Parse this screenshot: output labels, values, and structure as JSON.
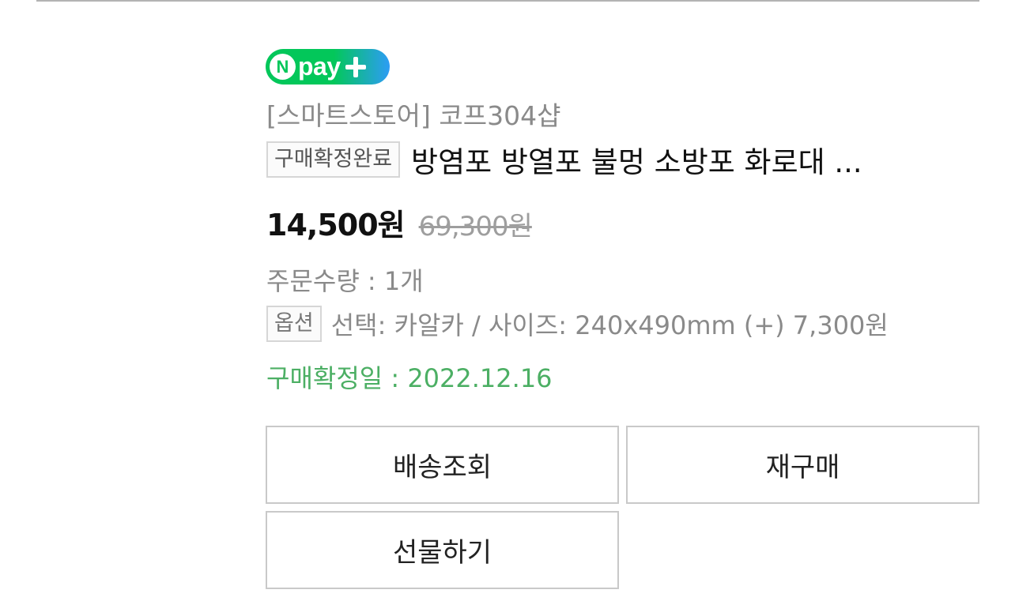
{
  "badge": {
    "n_letter": "N",
    "pay_text": "pay",
    "icon": "plus-icon",
    "colors": {
      "green": "#03c75a",
      "blue": "#2d9cf5"
    }
  },
  "order": {
    "store": "[스마트스토어] 코프304샵",
    "status_tag": "구매확정완료",
    "product_title": "방염포 방열포 불멍 소방포 화로대 ...",
    "sale_price": "14,500원",
    "original_price": "69,300원",
    "quantity": "주문수량 : 1개",
    "option_tag": "옵션",
    "option_text": "선택: 카알카 / 사이즈: 240x490mm (+) 7,300원",
    "confirm_date": "구매확정일 : 2022.12.16"
  },
  "actions": {
    "tracking": "배송조회",
    "rebuy": "재구매",
    "gift": "선물하기"
  },
  "colors": {
    "confirm_green": "#4caf64",
    "muted_text": "#8a8a8a",
    "border": "#c9c9c9"
  }
}
